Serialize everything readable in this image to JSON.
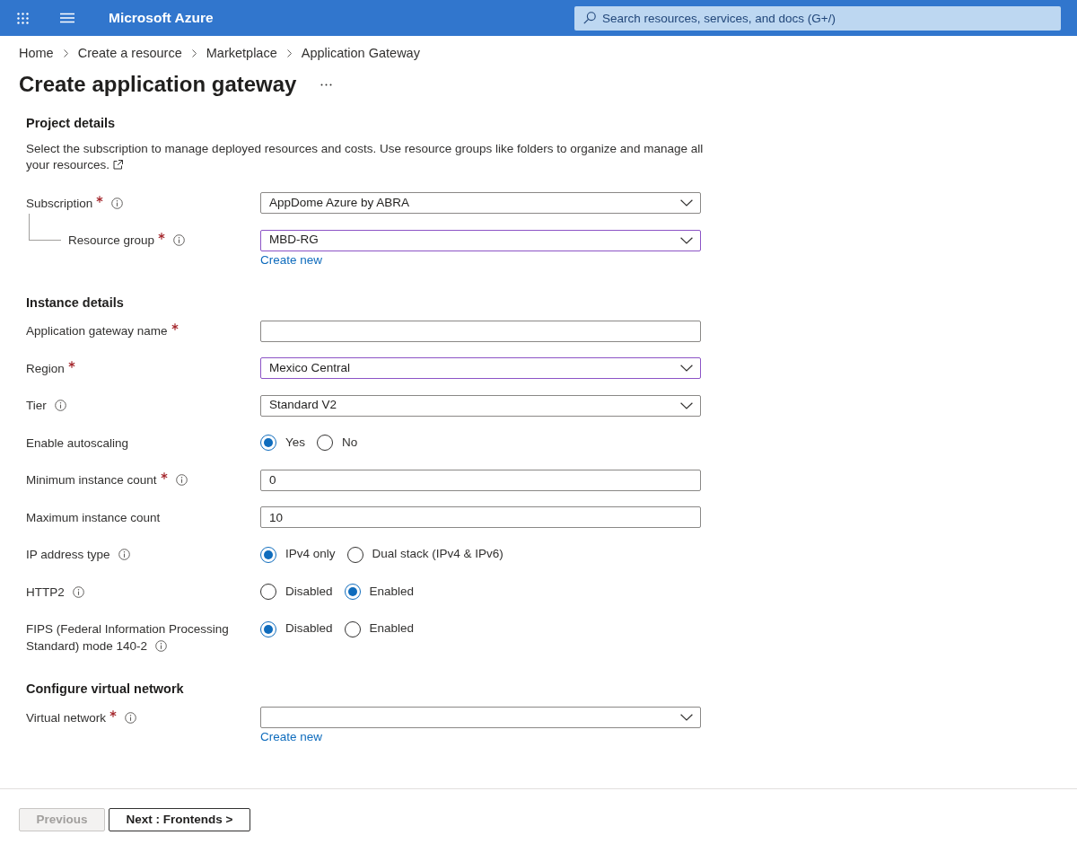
{
  "top_bar": {
    "title": "Microsoft Azure",
    "search": {
      "placeholder": "Search resources, services, and docs (G+/)"
    }
  },
  "breadcrumb": [
    "Home",
    "Create a resource",
    "Marketplace",
    "Application Gateway"
  ],
  "page": {
    "title": "Create application gateway"
  },
  "sections": [
    {
      "heading": "Project details",
      "description": "Select the subscription to manage deployed resources and costs. Use resource groups like folders to organize and manage all your resources.",
      "external_link": true,
      "fields": [
        {
          "kind": "dropdown",
          "label": "Subscription",
          "required": true,
          "info": true,
          "value": "AppDome Azure by ABRA",
          "modified": false,
          "children": [
            {
              "kind": "dropdown",
              "label": "Resource group",
              "required": true,
              "info": true,
              "value": "MBD-RG",
              "modified": true,
              "link": "Create new"
            }
          ]
        }
      ]
    },
    {
      "heading": "Instance details",
      "fields": [
        {
          "kind": "text",
          "label": "Application gateway name",
          "required": true,
          "info": false
        },
        {
          "kind": "dropdown",
          "label": "Region",
          "required": true,
          "info": false,
          "value": "Mexico Central",
          "modified": true
        },
        {
          "kind": "dropdown",
          "label": "Tier",
          "required": false,
          "info": true,
          "value": "Standard V2",
          "modified": false
        },
        {
          "kind": "radio",
          "label": "Enable autoscaling",
          "required": false,
          "info": false,
          "options": [
            {
              "label": "Yes",
              "selected": true
            },
            {
              "label": "No",
              "selected": false
            }
          ]
        },
        {
          "kind": "text",
          "label": "Minimum instance count",
          "required": true,
          "info": true,
          "value": "0"
        },
        {
          "kind": "text",
          "label": "Maximum instance count",
          "required": false,
          "info": false,
          "value": "10"
        },
        {
          "kind": "radio",
          "label": "IP address type",
          "required": false,
          "info": true,
          "options": [
            {
              "label": "IPv4 only",
              "selected": true
            },
            {
              "label": "Dual stack (IPv4 & IPv6)",
              "selected": false
            }
          ]
        },
        {
          "kind": "radio",
          "label": "HTTP2",
          "required": false,
          "info": true,
          "options": [
            {
              "label": "Disabled",
              "selected": false
            },
            {
              "label": "Enabled",
              "selected": true
            }
          ]
        },
        {
          "kind": "radio",
          "label": "FIPS (Federal Information Processing Standard) mode 140-2",
          "required": false,
          "info": true,
          "options": [
            {
              "label": "Disabled",
              "selected": true
            },
            {
              "label": "Enabled",
              "selected": false
            }
          ]
        }
      ]
    },
    {
      "heading": "Configure virtual network",
      "fields": [
        {
          "kind": "dropdown",
          "label": "Virtual network",
          "required": true,
          "info": true,
          "modified": false,
          "link": "Create new"
        }
      ]
    }
  ],
  "footer": {
    "buttons": [
      {
        "label": "Previous",
        "disabled": true
      },
      {
        "label": "Next : Frontends >",
        "disabled": false
      }
    ]
  }
}
